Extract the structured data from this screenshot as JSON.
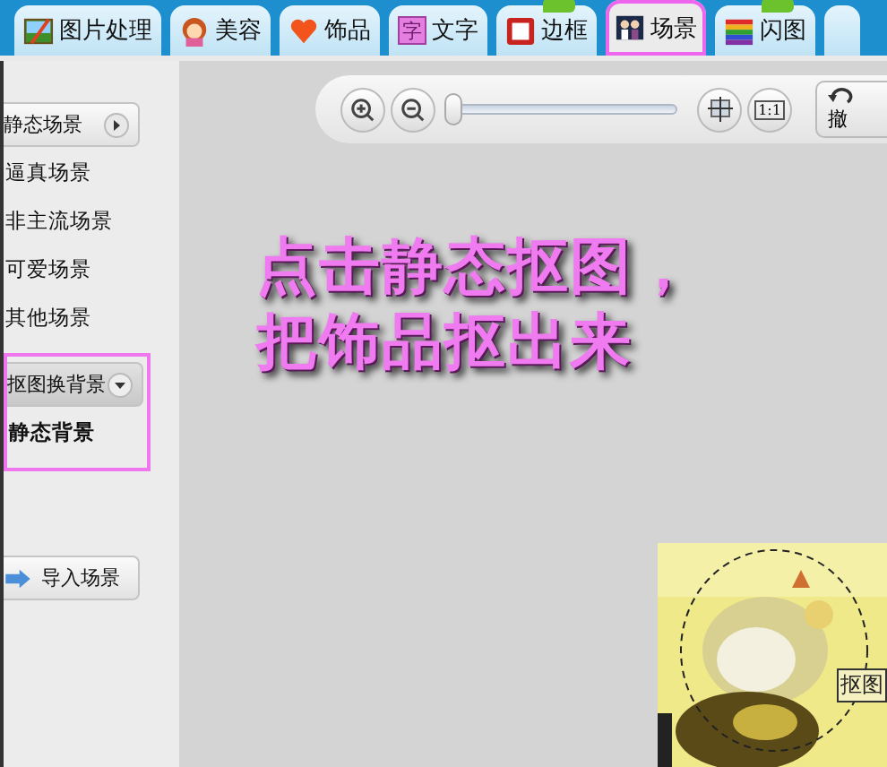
{
  "tabs": [
    {
      "label": "图片处理",
      "selected": false,
      "badge": false,
      "highlighted": false
    },
    {
      "label": "美容",
      "selected": false,
      "badge": false,
      "highlighted": false
    },
    {
      "label": "饰品",
      "selected": false,
      "badge": false,
      "highlighted": false
    },
    {
      "label": "文字",
      "icon_text": "字",
      "selected": false,
      "badge": false,
      "highlighted": false
    },
    {
      "label": "边框",
      "selected": false,
      "badge": true,
      "highlighted": false
    },
    {
      "label": "场景",
      "selected": true,
      "badge": false,
      "highlighted": true
    },
    {
      "label": "闪图",
      "selected": false,
      "badge": true,
      "highlighted": false
    }
  ],
  "sidebar": {
    "items": [
      {
        "kind": "button",
        "label": "静态场景",
        "highlighted": false
      },
      {
        "kind": "link",
        "label": "逼真场景",
        "highlighted": false
      },
      {
        "kind": "link",
        "label": "非主流场景",
        "highlighted": false
      },
      {
        "kind": "link",
        "label": "可爱场景",
        "highlighted": false
      },
      {
        "kind": "link",
        "label": "其他场景",
        "highlighted": false
      },
      {
        "kind": "dropdown",
        "label": "抠图换背景",
        "highlighted": true
      },
      {
        "kind": "bold",
        "label": "静态背景",
        "highlighted": true
      },
      {
        "kind": "import",
        "label": "导入场景",
        "highlighted": false
      }
    ]
  },
  "toolbar": {
    "zoom": {
      "level": 0
    },
    "actual_size": "1:1",
    "undo": "撤"
  },
  "instruction": {
    "lines": [
      "点击静态抠图，",
      "把饰品抠出来"
    ]
  },
  "canvas": {
    "tag": "抠图"
  }
}
